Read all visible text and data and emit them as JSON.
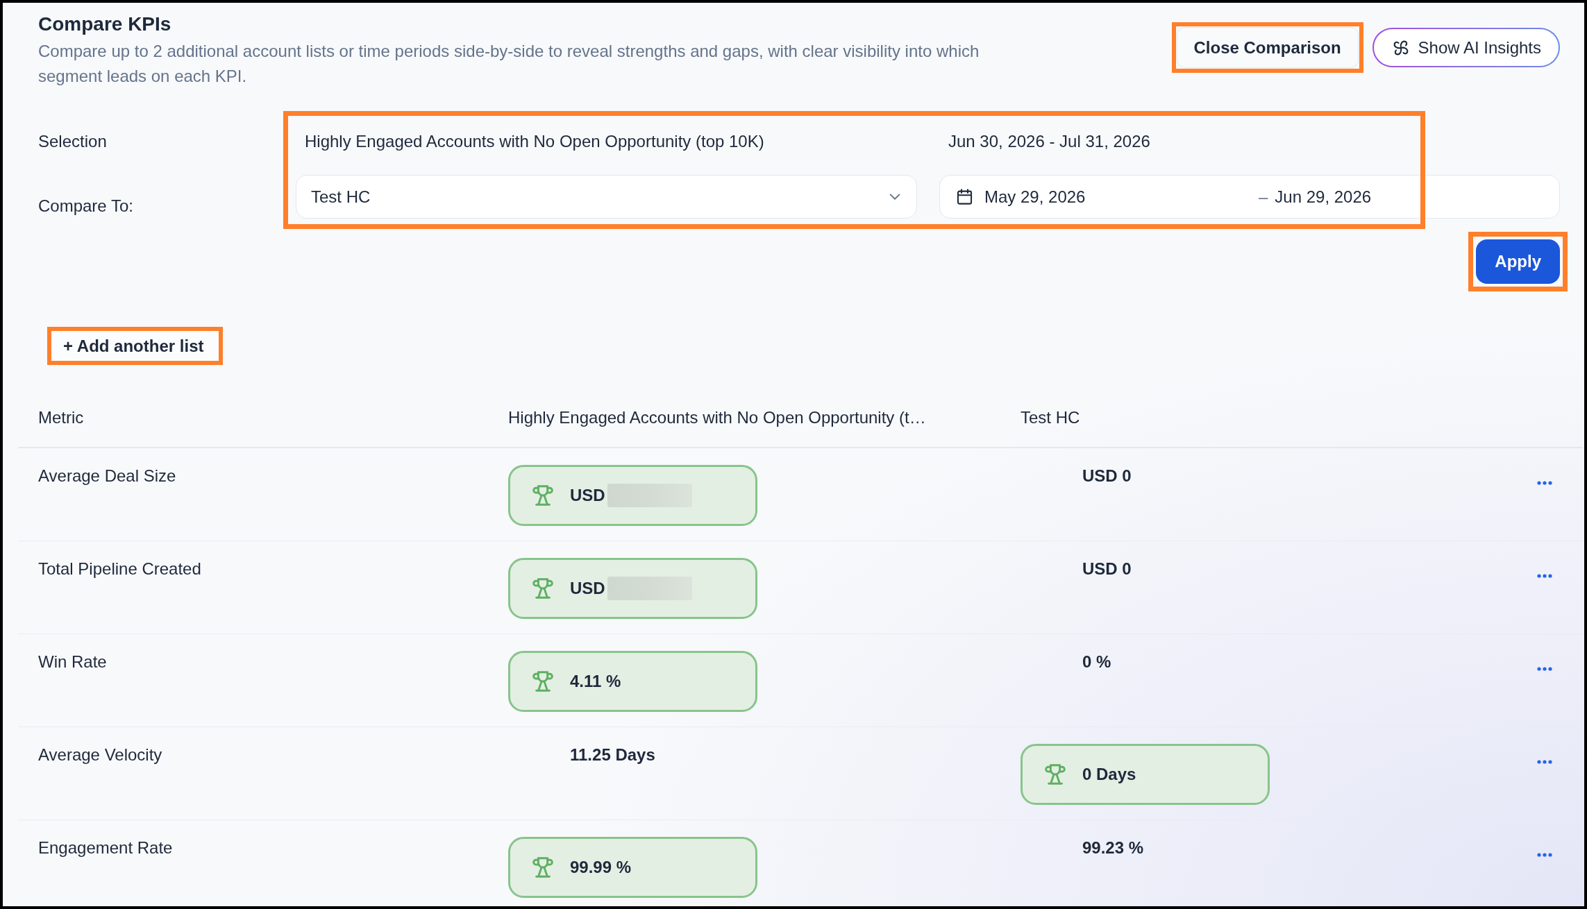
{
  "header": {
    "title": "Compare KPIs",
    "description": "Compare up to 2 additional account lists or time periods side-by-side to reveal strengths and gaps, with clear visibility into which segment leads on each KPI.",
    "buttons": [
      {
        "kind": "outline",
        "label": "Close Comparison",
        "highlighted": true
      },
      {
        "kind": "ai",
        "label": "Show AI Insights",
        "highlighted": false
      }
    ]
  },
  "selection_form": {
    "highlighted": true,
    "selection": {
      "label": "Selection",
      "list": "Highly Engaged Accounts with No Open Opportunity (top 10K)",
      "date_range": "Jun 30, 2026 - Jul 31, 2026"
    },
    "compare_to": {
      "label": "Compare To:",
      "list": {
        "value": "Test HC"
      },
      "date_range": {
        "start": "May 29, 2026",
        "separator": "–",
        "end": "Jun 29, 2026"
      }
    }
  },
  "apply_button": {
    "label": "Apply",
    "highlighted": true
  },
  "add_list_button": {
    "label": "+ Add another list",
    "highlighted": true
  },
  "table": {
    "columns": [
      "Metric",
      "Highly Engaged Accounts with No Open Opportunity (t…",
      "Test HC"
    ],
    "rows": [
      {
        "metric": "Average Deal Size",
        "values": [
          {
            "text": "USD",
            "redacted": true,
            "winner": true
          },
          {
            "text": "USD 0",
            "redacted": false,
            "winner": false
          }
        ]
      },
      {
        "metric": "Total Pipeline Created",
        "values": [
          {
            "text": "USD",
            "redacted": true,
            "winner": true
          },
          {
            "text": "USD 0",
            "redacted": false,
            "winner": false
          }
        ]
      },
      {
        "metric": "Win Rate",
        "values": [
          {
            "text": "4.11 %",
            "redacted": false,
            "winner": true
          },
          {
            "text": "0 %",
            "redacted": false,
            "winner": false
          }
        ]
      },
      {
        "metric": "Average Velocity",
        "values": [
          {
            "text": "11.25 Days",
            "redacted": false,
            "winner": false
          },
          {
            "text": "0 Days",
            "redacted": false,
            "winner": true
          }
        ]
      },
      {
        "metric": "Engagement Rate",
        "values": [
          {
            "text": "99.99 %",
            "redacted": false,
            "winner": true
          },
          {
            "text": "99.23 %",
            "redacted": false,
            "winner": false
          }
        ]
      }
    ]
  }
}
